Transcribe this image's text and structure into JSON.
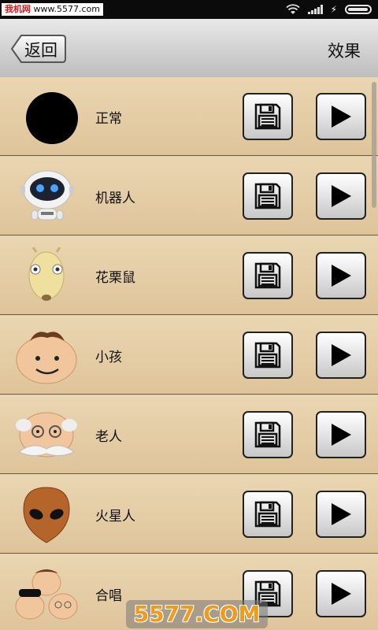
{
  "status_bar": {
    "watermark_text_red": "我机网",
    "watermark_text": " www.5577.com",
    "icons": [
      "wifi-icon",
      "signal-icon",
      "charging-icon",
      "battery-icon"
    ],
    "battery_level": 0.95
  },
  "header": {
    "back_label": "返回",
    "title": "效果"
  },
  "list": {
    "items": [
      {
        "label": "正常",
        "avatar": "black-circle"
      },
      {
        "label": "机器人",
        "avatar": "robot"
      },
      {
        "label": "花栗鼠",
        "avatar": "chipmunk"
      },
      {
        "label": "小孩",
        "avatar": "child-face"
      },
      {
        "label": "老人",
        "avatar": "old-man-face"
      },
      {
        "label": "火星人",
        "avatar": "alien-face"
      },
      {
        "label": "合唱",
        "avatar": "chorus-group"
      }
    ],
    "save_icon": "floppy-disk-icon",
    "play_icon": "play-icon"
  },
  "watermark_bottom": "5577.COM",
  "colors": {
    "header_bg": "#d6d6d6",
    "row_bg": "#e4cca4",
    "watermark_orange": "#f39a1a"
  }
}
